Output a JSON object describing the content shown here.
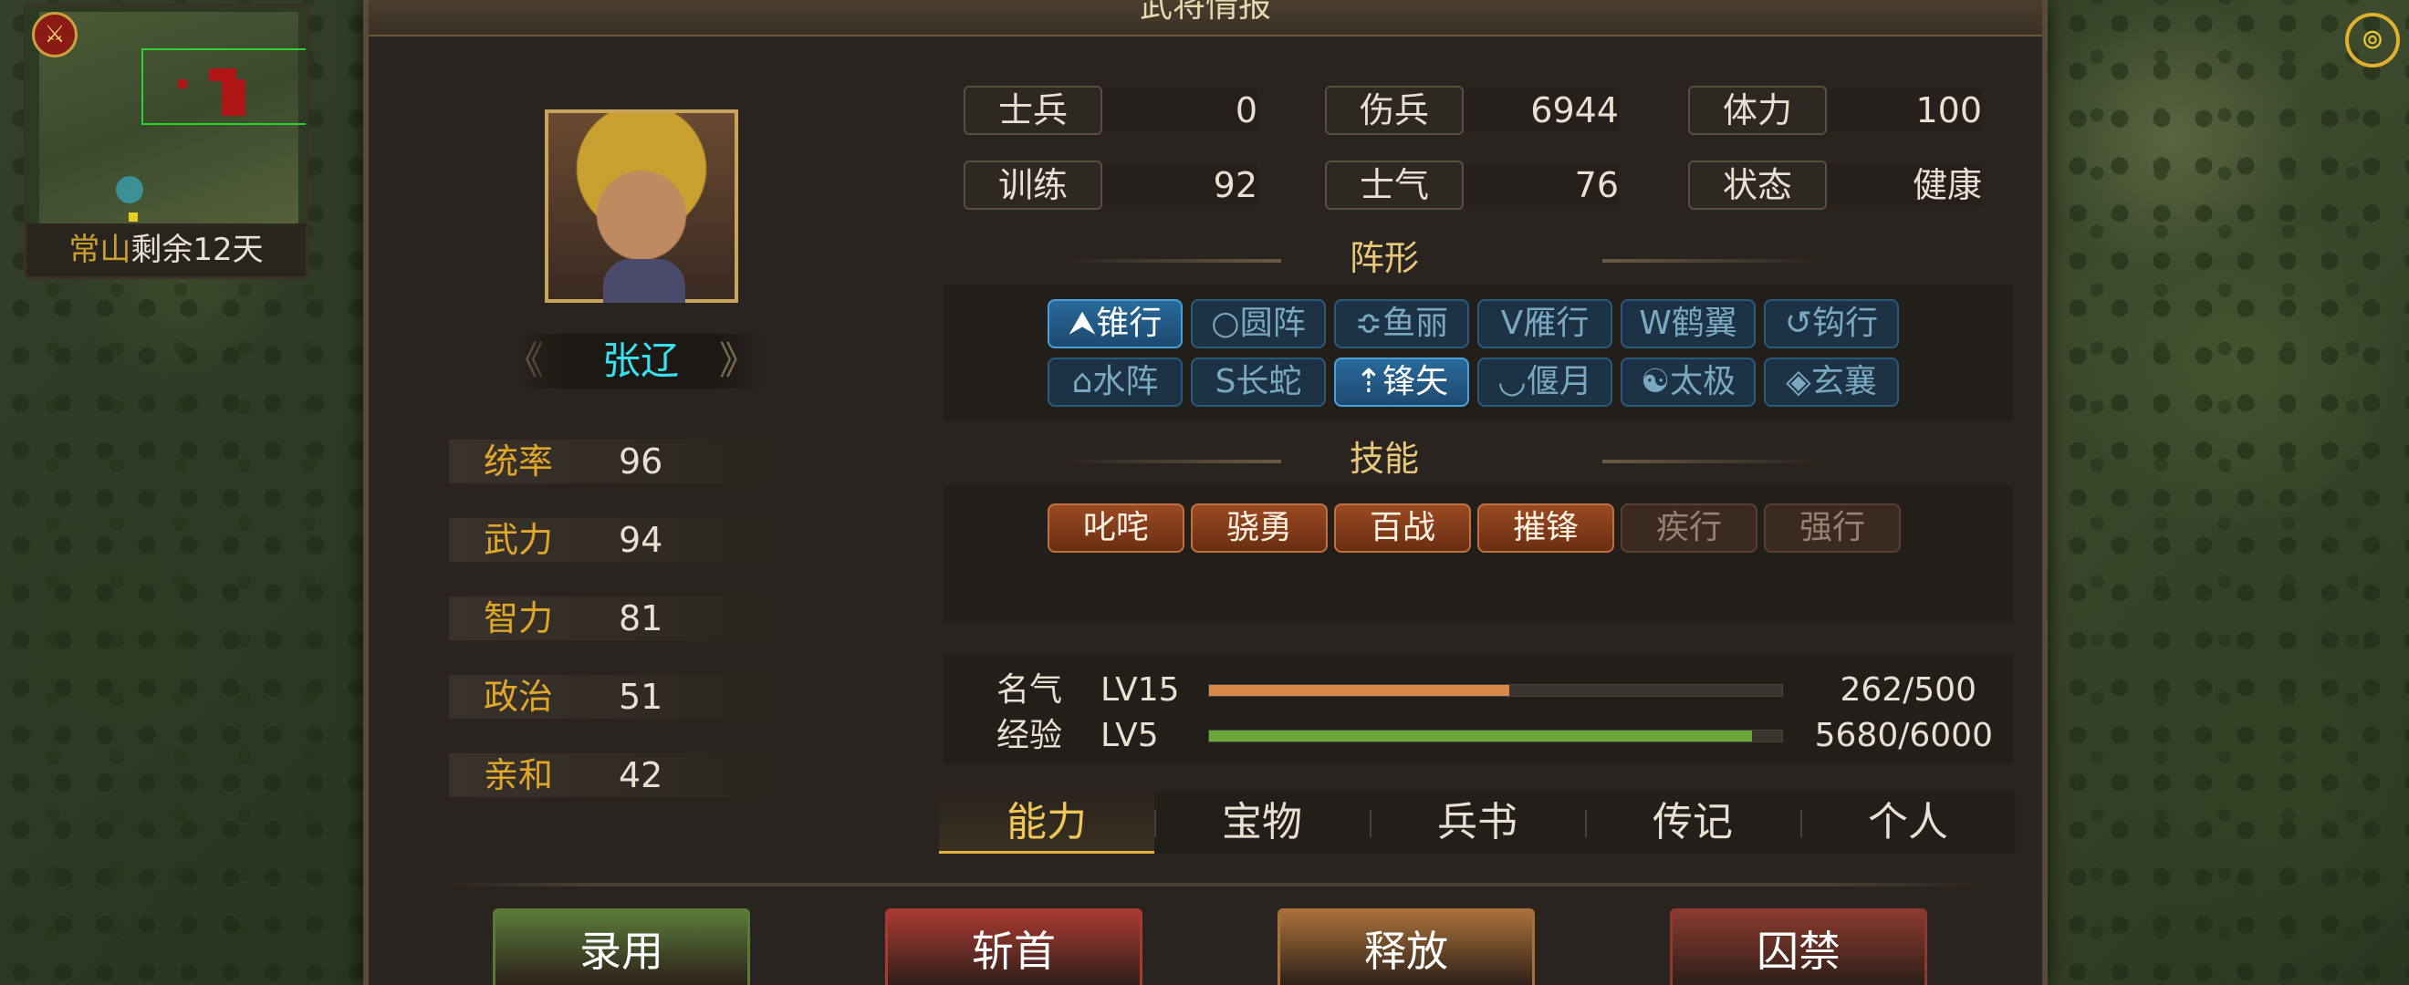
{
  "minimap": {
    "region": "常山",
    "days_left": "剩余12天"
  },
  "panel": {
    "title": "武将情报"
  },
  "general": {
    "name": "张辽"
  },
  "stats": [
    {
      "label": "统率",
      "value": "96"
    },
    {
      "label": "武力",
      "value": "94"
    },
    {
      "label": "智力",
      "value": "81"
    },
    {
      "label": "政治",
      "value": "51"
    },
    {
      "label": "亲和",
      "value": "42"
    }
  ],
  "info": [
    {
      "label": "士兵",
      "value": "0"
    },
    {
      "label": "伤兵",
      "value": "6944"
    },
    {
      "label": "体力",
      "value": "100"
    },
    {
      "label": "训练",
      "value": "92"
    },
    {
      "label": "士气",
      "value": "76"
    },
    {
      "label": "状态",
      "value": "健康"
    }
  ],
  "formation": {
    "title": "阵形",
    "items": [
      {
        "icon": "⮝",
        "label": "锥行",
        "active": true
      },
      {
        "icon": "○",
        "label": "圆阵",
        "active": false
      },
      {
        "icon": "≎",
        "label": "鱼丽",
        "active": false
      },
      {
        "icon": "V",
        "label": "雁行",
        "active": false
      },
      {
        "icon": "W",
        "label": "鹤翼",
        "active": false
      },
      {
        "icon": "↺",
        "label": "钩行",
        "active": false
      },
      {
        "icon": "⌂",
        "label": "水阵",
        "active": false
      },
      {
        "icon": "S",
        "label": "长蛇",
        "active": false
      },
      {
        "icon": "⇡",
        "label": "锋矢",
        "active": true
      },
      {
        "icon": "◡",
        "label": "偃月",
        "active": false
      },
      {
        "icon": "☯",
        "label": "太极",
        "active": false
      },
      {
        "icon": "◈",
        "label": "玄襄",
        "active": false
      }
    ]
  },
  "skills": {
    "title": "技能",
    "items": [
      {
        "label": "叱咤",
        "owned": true
      },
      {
        "label": "骁勇",
        "owned": true
      },
      {
        "label": "百战",
        "owned": true
      },
      {
        "label": "摧锋",
        "owned": true
      },
      {
        "label": "疾行",
        "owned": false
      },
      {
        "label": "强行",
        "owned": false
      }
    ]
  },
  "fame": {
    "label": "名气",
    "level": "LV15",
    "progress": "262/500",
    "ratio": 0.524,
    "color": "#d98a4a"
  },
  "exp": {
    "label": "经验",
    "level": "LV5",
    "progress": "5680/6000",
    "ratio": 0.947,
    "color": "#6aa83a"
  },
  "tabs": [
    {
      "label": "能力",
      "active": true
    },
    {
      "label": "宝物",
      "active": false
    },
    {
      "label": "兵书",
      "active": false
    },
    {
      "label": "传记",
      "active": false
    },
    {
      "label": "个人",
      "active": false
    }
  ],
  "actions": [
    {
      "label": "录用",
      "color": "#5a7a3a"
    },
    {
      "label": "斩首",
      "color": "#a83a32"
    },
    {
      "label": "释放",
      "color": "#a8703a"
    },
    {
      "label": "囚禁",
      "color": "#8a3a2e"
    }
  ]
}
